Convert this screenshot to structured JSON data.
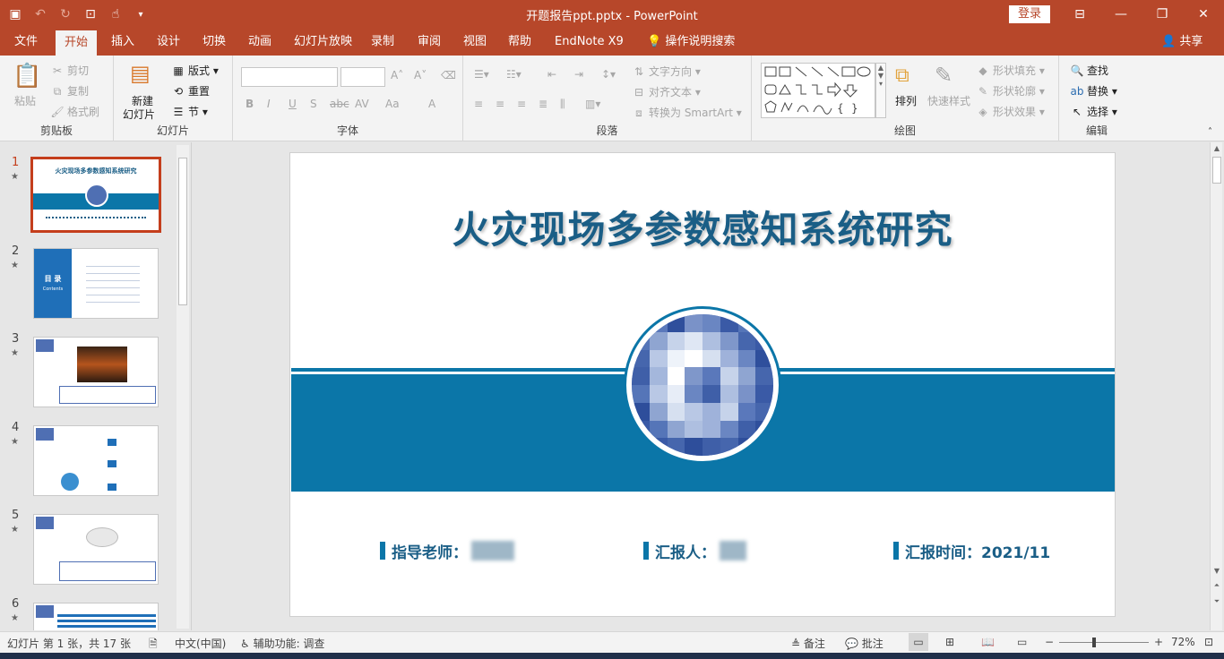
{
  "titlebar": {
    "title": "开题报告ppt.pptx  -  PowerPoint",
    "login_label": "登录",
    "qat_icons": [
      "save-icon",
      "undo-icon",
      "redo-icon",
      "present-icon",
      "touch-icon",
      "customize-icon"
    ]
  },
  "tabs": {
    "items": [
      "文件",
      "开始",
      "插入",
      "设计",
      "切换",
      "动画",
      "幻灯片放映",
      "录制",
      "审阅",
      "视图",
      "帮助",
      "EndNote X9",
      "操作说明搜索"
    ],
    "active": "开始",
    "share_label": "共享"
  },
  "ribbon": {
    "clipboard": {
      "label": "剪贴板",
      "paste": "粘贴",
      "cut": "剪切",
      "copy": "复制",
      "format_painter": "格式刷"
    },
    "slides": {
      "label": "幻灯片",
      "new_slide": "新建",
      "new_slide2": "幻灯片",
      "layout": "版式",
      "reset": "重置",
      "section": "节"
    },
    "font": {
      "label": "字体"
    },
    "paragraph": {
      "label": "段落",
      "text_direction": "文字方向",
      "align_text": "对齐文本",
      "smartart": "转换为 SmartArt"
    },
    "drawing": {
      "label": "绘图",
      "arrange": "排列",
      "quick_styles": "快速样式",
      "shape_fill": "形状填充",
      "shape_outline": "形状轮廓",
      "shape_effects": "形状效果"
    },
    "editing": {
      "label": "编辑",
      "find": "查找",
      "replace": "替换",
      "select": "选择"
    }
  },
  "thumbnails": [
    {
      "num": "1",
      "title": "火灾现场多参数感知系统研究"
    },
    {
      "num": "2",
      "title": "目 录",
      "subtitle": "Contents"
    },
    {
      "num": "3"
    },
    {
      "num": "4"
    },
    {
      "num": "5"
    },
    {
      "num": "6"
    }
  ],
  "slide": {
    "title": "火灾现场多参数感知系统研究",
    "advisor_label": "指导老师：",
    "reporter_label": "汇报人：",
    "time_label": "汇报时间：2021/11"
  },
  "status": {
    "slide_info": "幻灯片 第 1 张，共 17 张",
    "language": "中文(中国)",
    "accessibility": "辅助功能: 调查",
    "notes": "备注",
    "comments": "批注",
    "zoom": "72%",
    "zoom_fraction": 0.39
  },
  "colors": {
    "brand": "#b7472a",
    "slide_blue": "#0b76a8",
    "title_blue": "#1a5e86"
  }
}
